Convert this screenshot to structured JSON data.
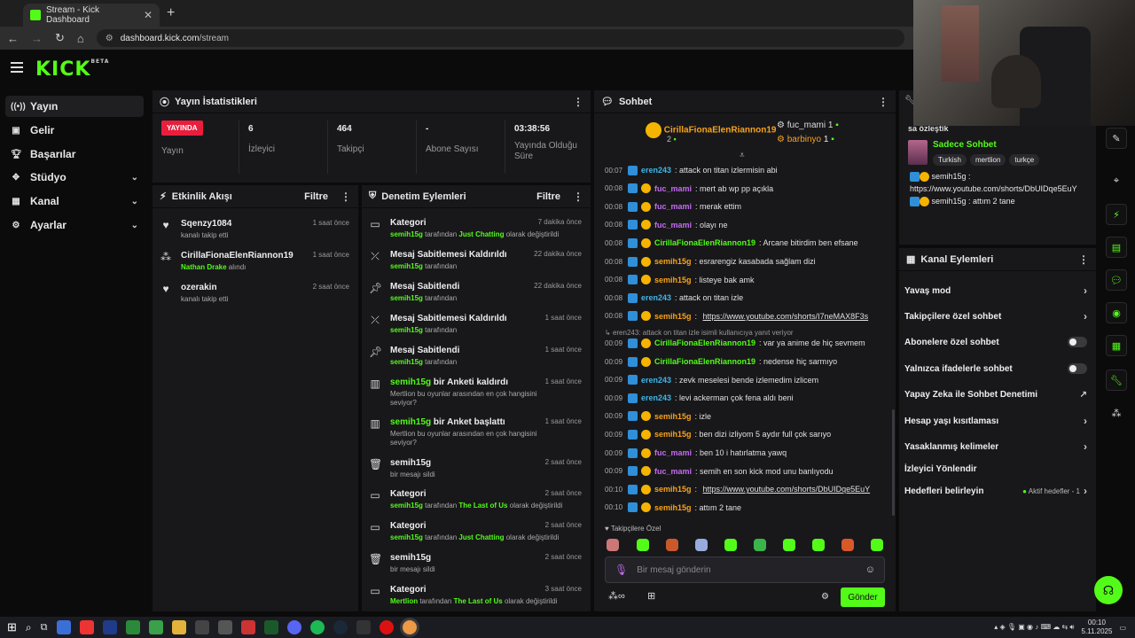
{
  "browser": {
    "tab_title": "Stream - Kick Dashboard",
    "url_host": "dashboard.kick.com",
    "url_path": "/stream"
  },
  "logo": "KICK",
  "logo_badge": "BETA",
  "sidebar": {
    "items": [
      {
        "label": "Yayın",
        "icon": "broadcast-icon"
      },
      {
        "label": "Gelir",
        "icon": "wallet-icon"
      },
      {
        "label": "Başarılar",
        "icon": "trophy-icon"
      },
      {
        "label": "Stüdyo",
        "icon": "studio-icon"
      },
      {
        "label": "Kanal",
        "icon": "channel-icon"
      },
      {
        "label": "Ayarlar",
        "icon": "gear-icon"
      }
    ]
  },
  "stats": {
    "title": "Yayın İstatistikleri",
    "live_badge": "YAYINDA",
    "live_label": "Yayın",
    "viewers_value": "6",
    "viewers_label": "İzleyici",
    "followers_value": "464",
    "followers_label": "Takipçi",
    "subs_value": "-",
    "subs_label": "Abone Sayısı",
    "uptime_value": "03:38:56",
    "uptime_label": "Yayında Olduğu Süre"
  },
  "activity": {
    "title": "Etkinlik Akışı",
    "filter": "Filtre",
    "items": [
      {
        "name": "Sqenzy1084",
        "desc": "kanalı takip etti",
        "time": "1 saat önce"
      },
      {
        "name": "CirillaFionaElenRiannon19",
        "desc_user": "Nathan Drake",
        "desc": " alındı",
        "time": "1 saat önce"
      },
      {
        "name": "ozerakin",
        "desc": "kanalı takip etti",
        "time": "2 saat önce"
      }
    ]
  },
  "moderation": {
    "title": "Denetim Eylemleri",
    "filter": "Filtre",
    "items": [
      {
        "title": "Kategori",
        "user": "semih15g",
        "mid": " tarafından ",
        "hl": "Just Chatting",
        "end": " olarak değiştirildi",
        "time": "7 dakika önce"
      },
      {
        "title": "Mesaj Sabitlemesi Kaldırıldı",
        "user": "semih15g",
        "mid": " tarafından",
        "hl": "",
        "end": "",
        "time": "22 dakika önce"
      },
      {
        "title": "Mesaj Sabitlendi",
        "user": "semih15g",
        "mid": " tarafından",
        "hl": "",
        "end": "",
        "time": "22 dakika önce"
      },
      {
        "title": "Mesaj Sabitlemesi Kaldırıldı",
        "user": "semih15g",
        "mid": " tarafından",
        "hl": "",
        "end": "",
        "time": "1 saat önce"
      },
      {
        "title": "Mesaj Sabitlendi",
        "user": "semih15g",
        "mid": " tarafından",
        "hl": "",
        "end": "",
        "time": "1 saat önce"
      },
      {
        "title_user": "semih15g",
        "title": " bir Anketi kaldırdı",
        "desc": "Mertlion bu oyunlar arasından en çok hangisini seviyor?",
        "time": "1 saat önce"
      },
      {
        "title_user": "semih15g",
        "title": " bir Anket başlattı",
        "desc": "Mertlion bu oyunlar arasından en çok hangisini seviyor?",
        "time": "1 saat önce"
      },
      {
        "title": "semih15g",
        "desc": "bir mesajı sildi",
        "time": "2 saat önce"
      },
      {
        "title": "Kategori",
        "user": "semih15g",
        "mid": " tarafından ",
        "hl": "The Last of Us",
        "end": " olarak değiştirildi",
        "time": "2 saat önce"
      },
      {
        "title": "Kategori",
        "user": "semih15g",
        "mid": " tarafından ",
        "hl": "Just Chatting",
        "end": " olarak değiştirildi",
        "time": "2 saat önce"
      },
      {
        "title": "semih15g",
        "desc": "bir mesajı sildi",
        "time": "2 saat önce"
      },
      {
        "title": "Kategori",
        "user": "Mertlion",
        "mid": " tarafından ",
        "hl": "The Last of Us",
        "end": " olarak değiştirildi",
        "time": "3 saat önce"
      }
    ]
  },
  "chat": {
    "title": "Sohbet",
    "leader1_name": "CirillaFionaElenRiannon19",
    "leader1_count": "2",
    "leader2_name": "fuc_mami",
    "leader2_count": "1",
    "leader3_name": "barbinyo",
    "leader3_count": "1",
    "reply_note": "eren243: attack on titan izle isimli kullanıcıya yanıt veriyor",
    "messages": [
      {
        "t": "00:07",
        "u": "eren243",
        "c": "ucyan",
        "m": ": attack on titan izlermisin abi"
      },
      {
        "t": "00:08",
        "u": "fuc_mami",
        "c": "upurple",
        "m": ": mert ab wp pp açıkla"
      },
      {
        "t": "00:08",
        "u": "fuc_mami",
        "c": "upurple",
        "m": ": merak ettim"
      },
      {
        "t": "00:08",
        "u": "fuc_mami",
        "c": "upurple",
        "m": ": olayı ne"
      },
      {
        "t": "00:08",
        "u": "CirillaFionaElenRiannon19",
        "c": "ugreen",
        "m": ": Arcane bitirdim ben efsane"
      },
      {
        "t": "00:08",
        "u": "semih15g",
        "c": "uorange",
        "m": ": esrarengiz kasabada sağlam dizi"
      },
      {
        "t": "00:08",
        "u": "semih15g",
        "c": "uorange",
        "m": ": listeye bak amk"
      },
      {
        "t": "00:08",
        "u": "eren243",
        "c": "ucyan",
        "m": ": attack on titan izle"
      },
      {
        "t": "00:08",
        "u": "semih15g",
        "c": "uorange",
        "m": ": ",
        "link": "https://www.youtube.com/shorts/I7neMAX8F3s"
      },
      {
        "t": "00:09",
        "u": "CirillaFionaElenRiannon19",
        "c": "ugreen",
        "m": ": var ya anime de hiç sevmem"
      },
      {
        "t": "00:09",
        "u": "CirillaFionaElenRiannon19",
        "c": "ugreen",
        "m": ": nedense hiç sarmıyo"
      },
      {
        "t": "00:09",
        "u": "eren243",
        "c": "ucyan",
        "m": ": zevk meselesi bende izlemedim izlicem"
      },
      {
        "t": "00:09",
        "u": "eren243",
        "c": "ucyan",
        "m": ": levi ackerman çok fena aldı beni"
      },
      {
        "t": "00:09",
        "u": "semih15g",
        "c": "uorange",
        "m": ": izle"
      },
      {
        "t": "00:09",
        "u": "semih15g",
        "c": "uorange",
        "m": ": ben dizi izliyom 5 aydır full çok sarıyo"
      },
      {
        "t": "00:09",
        "u": "fuc_mami",
        "c": "upurple",
        "m": ": ben 10 i hatırlatma yawq"
      },
      {
        "t": "00:09",
        "u": "fuc_mami",
        "c": "upurple",
        "m": ": semih en son kick mod unu banlıyodu"
      },
      {
        "t": "00:10",
        "u": "semih15g",
        "c": "uorange",
        "m": ": ",
        "link": "https://www.youtube.com/shorts/DbUIDqe5EuY"
      },
      {
        "t": "00:10",
        "u": "semih15g",
        "c": "uorange",
        "m": ": attım 2 tane"
      }
    ],
    "followers_only": "Takipçilere Özel",
    "input_placeholder": "Bir mesaj gönderin",
    "send": "Gönder"
  },
  "pinned": {
    "title_partial": "sa özleştik",
    "channel": "Sadece Sohbet",
    "tags": [
      "Turkish",
      "mertlion",
      "turkçe"
    ],
    "msg1_user": "semih15g",
    "msg1_text": " :",
    "msg1_link": "https://www.youtube.com/shorts/DbUIDqe5EuY",
    "msg2_user": "semih15g",
    "msg2_text": " : attım 2 tane"
  },
  "channel_actions": {
    "title": "Kanal Eylemleri",
    "items": [
      {
        "label": "Yavaş mod",
        "kind": "chev"
      },
      {
        "label": "Takipçilere özel sohbet",
        "kind": "chev"
      },
      {
        "label": "Abonelere özel sohbet",
        "kind": "toggle"
      },
      {
        "label": "Yalnızca ifadelerle sohbet",
        "kind": "toggle"
      },
      {
        "label": "Yapay Zeka ile Sohbet Denetimi",
        "kind": "ext"
      },
      {
        "label": "Hesap yaşı kısıtlaması",
        "kind": "chev"
      },
      {
        "label": "Yasaklanmış kelimeler",
        "kind": "chev"
      },
      {
        "label": "İzleyici Yönlendir",
        "kind": "none"
      },
      {
        "label": "Hedefleri belirleyin",
        "kind": "goal"
      }
    ],
    "goal_text": "Aktif hedefler - 1"
  },
  "taskbar": {
    "time": "00:10",
    "date": "5.11.2025"
  }
}
